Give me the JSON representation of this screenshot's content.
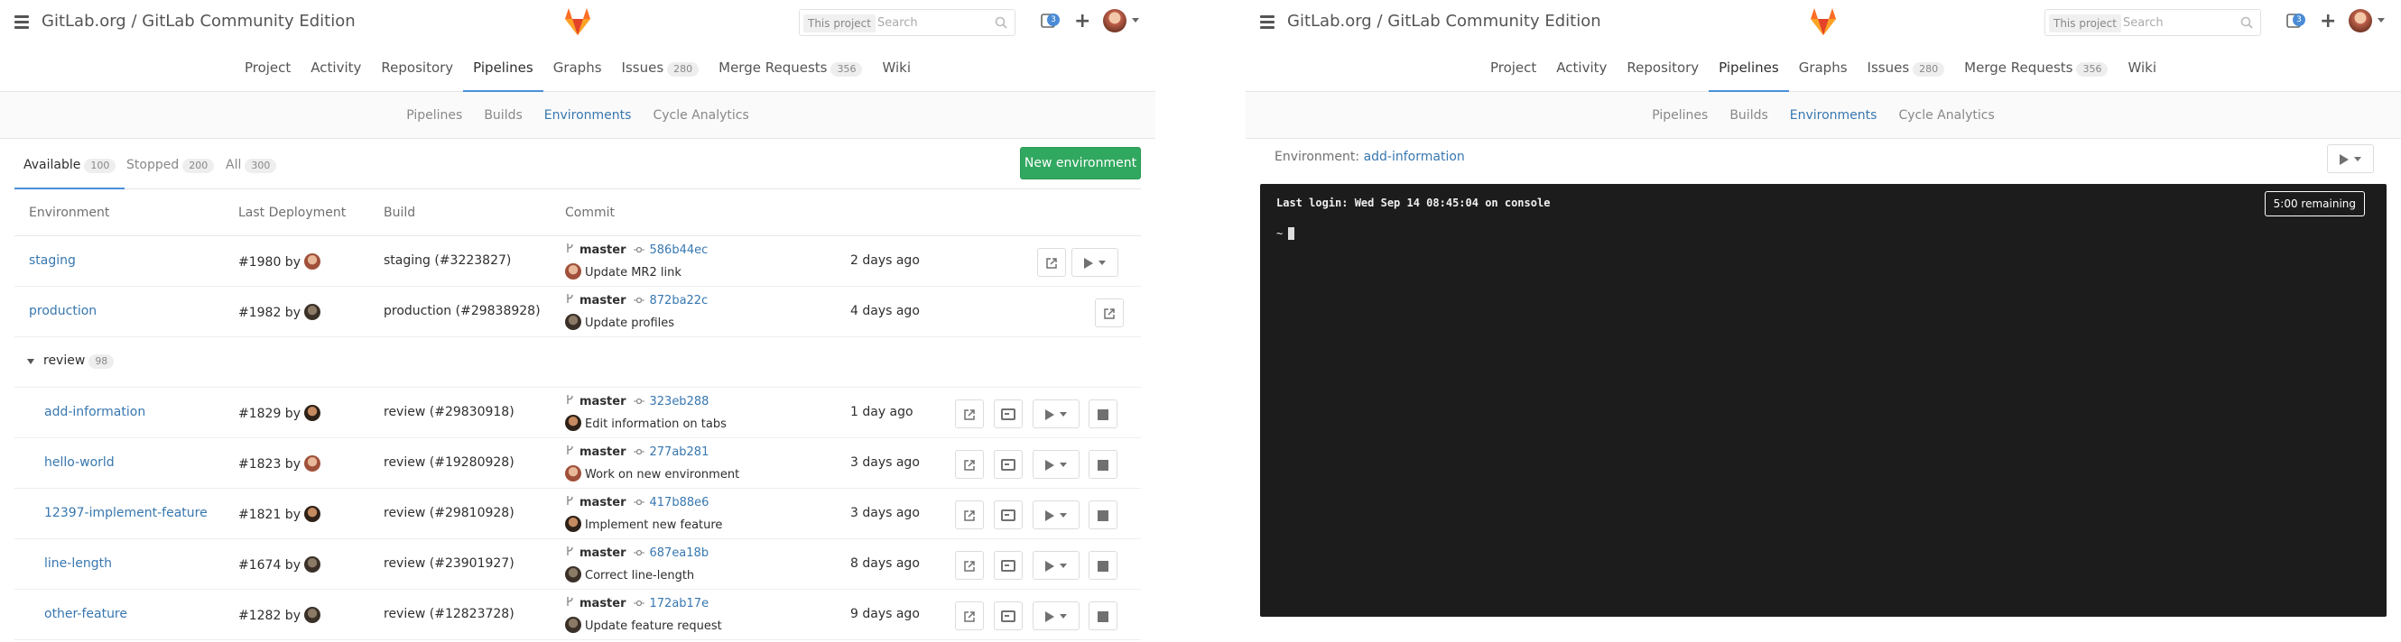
{
  "header": {
    "title": "GitLab.org / GitLab Community Edition",
    "search_scope": "This project",
    "search_placeholder": "Search",
    "notifications_count": "3",
    "brand_color": "#fc6d26"
  },
  "nav": {
    "tabs": [
      {
        "label": "Project"
      },
      {
        "label": "Activity"
      },
      {
        "label": "Repository"
      },
      {
        "label": "Pipelines"
      },
      {
        "label": "Graphs"
      },
      {
        "label": "Issues",
        "count": "280"
      },
      {
        "label": "Merge Requests",
        "count": "356"
      },
      {
        "label": "Wiki"
      }
    ],
    "active": "Pipelines"
  },
  "subnav": {
    "tabs": [
      "Pipelines",
      "Builds",
      "Environments",
      "Cycle Analytics"
    ],
    "active": "Environments"
  },
  "env_tabs": [
    {
      "label": "Available",
      "count": "100"
    },
    {
      "label": "Stopped",
      "count": "200"
    },
    {
      "label": "All",
      "count": "300"
    }
  ],
  "new_env_label": "New environment",
  "columns": [
    "Environment",
    "Last Deployment",
    "Build",
    "Commit"
  ],
  "rows": [
    {
      "name": "staging",
      "deployment": "#1980 by",
      "build": "staging (#3223827)",
      "branch": "master",
      "sha": "586b44ec",
      "message": "Update MR2 link",
      "ago": "2 days ago"
    },
    {
      "name": "production",
      "deployment": "#1982 by",
      "build": "production (#29838928)",
      "branch": "master",
      "sha": "872ba22c",
      "message": "Update profiles",
      "ago": "4 days ago"
    }
  ],
  "group": {
    "name": "review",
    "count": "98"
  },
  "review_rows": [
    {
      "name": "add-information",
      "deployment": "#1829 by",
      "build": "review (#29830918)",
      "branch": "master",
      "sha": "323eb288",
      "message": "Edit information on tabs",
      "ago": "1 day ago"
    },
    {
      "name": "hello-world",
      "deployment": "#1823 by",
      "build": "review (#19280928)",
      "branch": "master",
      "sha": "277ab281",
      "message": "Work on new environment",
      "ago": "3 days ago"
    },
    {
      "name": "12397-implement-feature",
      "deployment": "#1821 by",
      "build": "review (#29810928)",
      "branch": "master",
      "sha": "417b88e6",
      "message": "Implement new feature",
      "ago": "3 days ago"
    },
    {
      "name": "line-length",
      "deployment": "#1674 by",
      "build": "review (#23901927)",
      "branch": "master",
      "sha": "687ea18b",
      "message": "Correct line-length",
      "ago": "8 days ago"
    },
    {
      "name": "other-feature",
      "deployment": "#1282 by",
      "build": "review (#12823728)",
      "branch": "master",
      "sha": "172ab17e",
      "message": "Update feature request",
      "ago": "9 days ago"
    }
  ],
  "terminal_view": {
    "environment_label": "Environment:",
    "environment_name": "add-information",
    "last_login": "Last login: Wed Sep 14 08:45:04 on console",
    "prompt": "~",
    "remaining": "5:00 remaining"
  }
}
